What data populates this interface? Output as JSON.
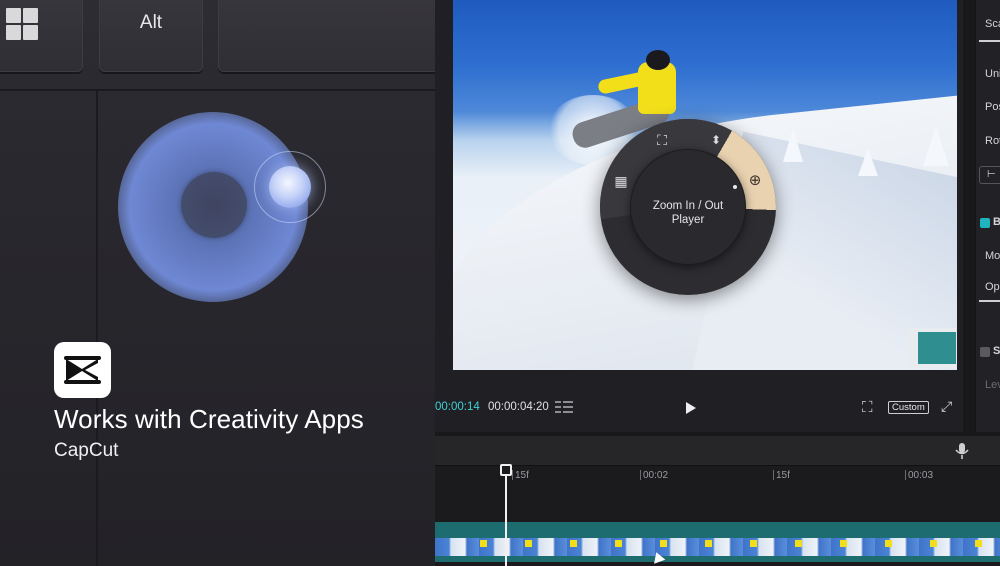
{
  "keyboard": {
    "alt_key_label": "Alt",
    "windows_key_icon": "windows-logo-icon"
  },
  "promo": {
    "logo_icon": "capcut-logo-icon",
    "tagline": "Works with Creativity Apps",
    "app_name": "CapCut"
  },
  "radial_menu": {
    "center_label_line1": "Zoom In / Out",
    "center_label_line2": "Player",
    "active_color": "#e9d2b0",
    "icons": [
      "focus-frame-icon",
      "up-down-arrows-icon",
      "zoom-in-icon",
      "calendar-icon"
    ]
  },
  "transport": {
    "current_time": "00:00:14",
    "total_time": "00:00:04:20",
    "custom_label": "Custom"
  },
  "properties": {
    "items": [
      "Scale",
      "Unif",
      "Posit",
      "Rota",
      "B",
      "Mod",
      "Opa",
      "S",
      "Leve"
    ]
  },
  "timeline": {
    "ticks": [
      "15f",
      "00:02",
      "15f",
      "00:03"
    ],
    "track_color": "#1d6c6f",
    "accent": "#3fd0d8"
  }
}
